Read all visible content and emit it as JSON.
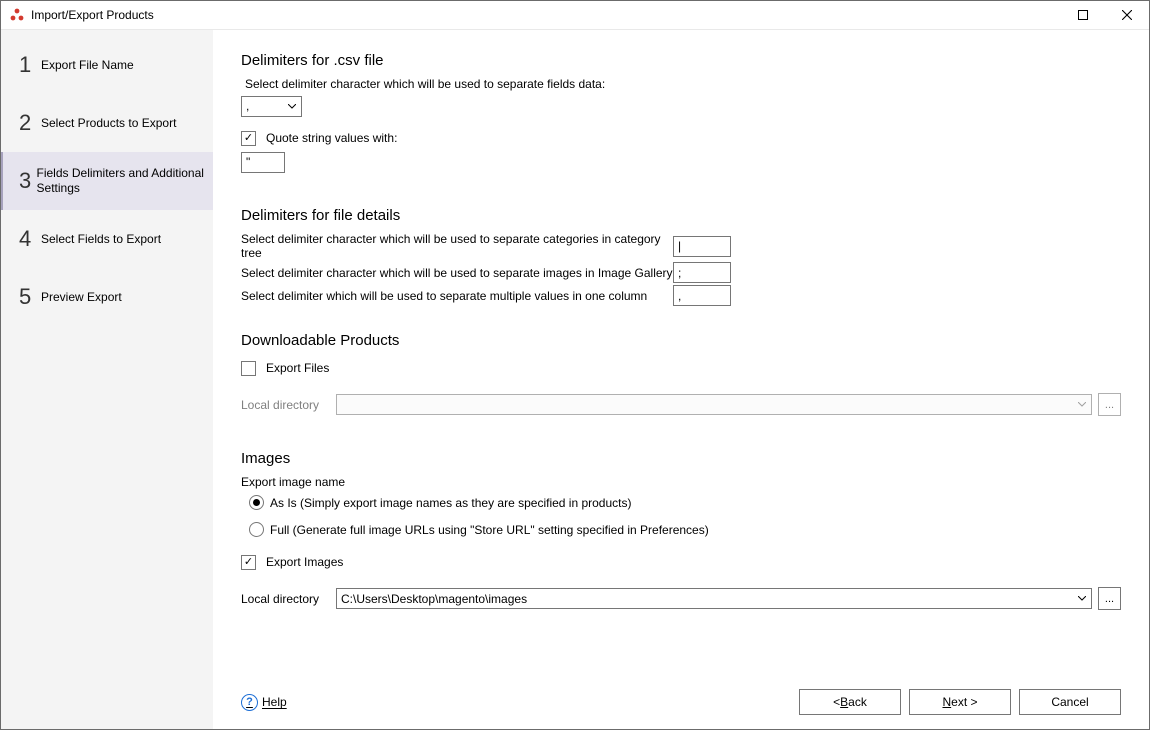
{
  "window": {
    "title": "Import/Export Products"
  },
  "sidebar": {
    "steps": [
      {
        "num": "1",
        "label": "Export File Name"
      },
      {
        "num": "2",
        "label": "Select Products to Export"
      },
      {
        "num": "3",
        "label": "Fields Delimiters and Additional Settings"
      },
      {
        "num": "4",
        "label": "Select Fields to Export"
      },
      {
        "num": "5",
        "label": "Preview Export"
      }
    ],
    "active_index": 2
  },
  "sections": {
    "csv": {
      "heading": "Delimiters for .csv file",
      "hint": "Select delimiter character which will be used to separate fields data:",
      "delimiter_value": ",",
      "quote_checkbox_label": "Quote string values with:",
      "quote_checked": true,
      "quote_value": "\""
    },
    "details": {
      "heading": "Delimiters for file details",
      "rows": [
        {
          "label": "Select delimiter character which will be used to separate categories in category tree",
          "value": "|"
        },
        {
          "label": "Select delimiter character which will be used to separate images in Image Gallery",
          "value": ";"
        },
        {
          "label": "Select delimiter which will be used to separate multiple values in one column",
          "value": ","
        }
      ]
    },
    "download": {
      "heading": "Downloadable Products",
      "export_files_label": "Export Files",
      "export_files_checked": false,
      "local_dir_label": "Local directory",
      "local_dir_value": "",
      "browse_label": "..."
    },
    "images": {
      "heading": "Images",
      "export_name_label": "Export image name",
      "radio_asis": "As Is (Simply export image names as they are specified in products)",
      "radio_full": "Full (Generate full image URLs using \"Store URL\" setting specified in Preferences)",
      "radio_selected": "asis",
      "export_images_label": "Export Images",
      "export_images_checked": true,
      "local_dir_label": "Local directory",
      "local_dir_value": "C:\\Users\\Desktop\\magento\\images",
      "browse_label": "..."
    }
  },
  "footer": {
    "help_label": "Help",
    "back_prefix": "< ",
    "back_mnemonic": "B",
    "back_suffix": "ack",
    "next_mnemonic": "N",
    "next_suffix": "ext >",
    "cancel_label": "Cancel"
  }
}
